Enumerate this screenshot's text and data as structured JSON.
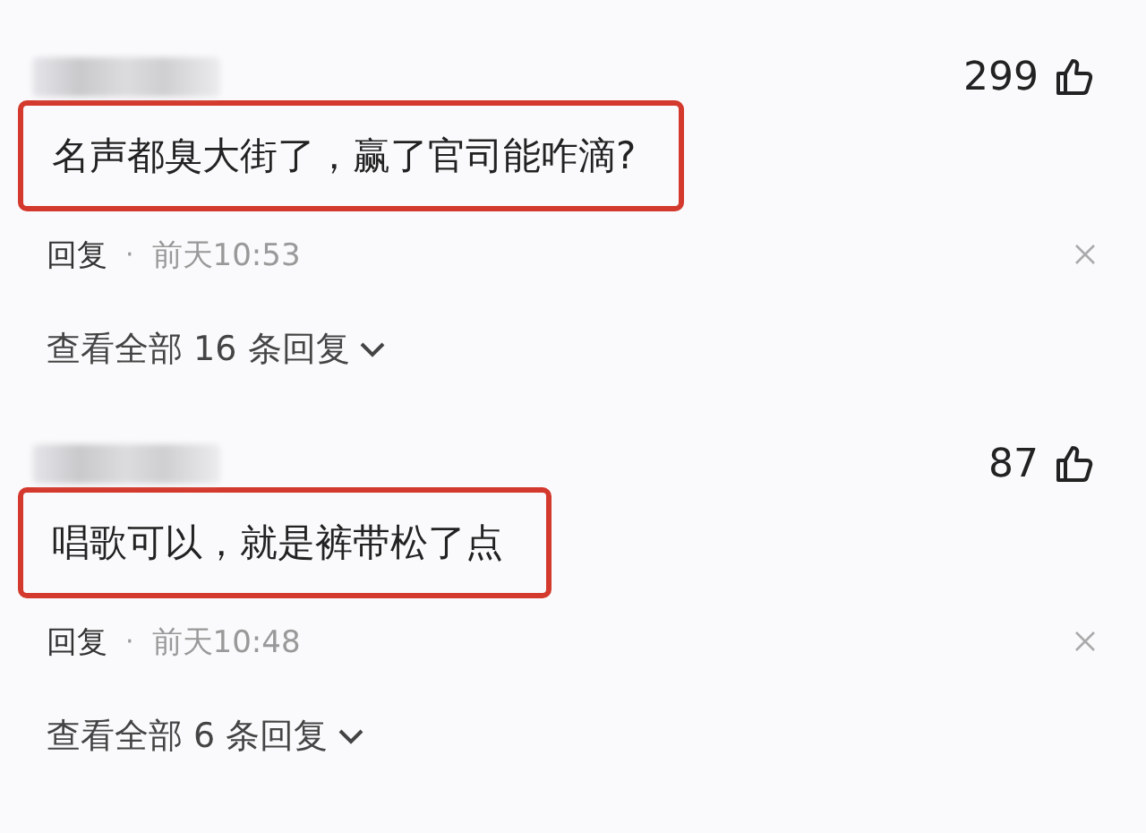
{
  "comments": [
    {
      "likes": "299",
      "text": "名声都臭大街了，赢了官司能咋滴?",
      "highlighted": true,
      "reply": "回复",
      "dot": "·",
      "time": "前天10:53",
      "view_replies": "查看全部 16 条回复"
    },
    {
      "likes": "87",
      "text": "唱歌可以，就是裤带松了点",
      "highlighted": true,
      "reply": "回复",
      "dot": "·",
      "time": "前天10:48",
      "view_replies": "查看全部 6 条回复"
    }
  ]
}
